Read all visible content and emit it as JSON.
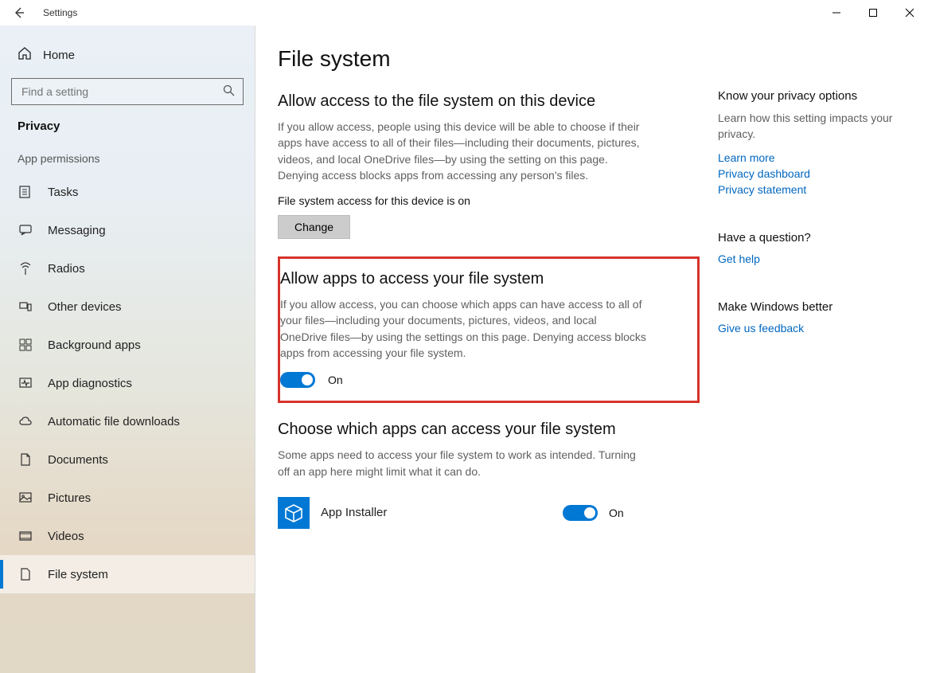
{
  "window": {
    "title": "Settings"
  },
  "sidebar": {
    "home": "Home",
    "search_placeholder": "Find a setting",
    "section": "Privacy",
    "subsection": "App permissions",
    "items": [
      {
        "label": "Tasks"
      },
      {
        "label": "Messaging"
      },
      {
        "label": "Radios"
      },
      {
        "label": "Other devices"
      },
      {
        "label": "Background apps"
      },
      {
        "label": "App diagnostics"
      },
      {
        "label": "Automatic file downloads"
      },
      {
        "label": "Documents"
      },
      {
        "label": "Pictures"
      },
      {
        "label": "Videos"
      },
      {
        "label": "File system"
      }
    ]
  },
  "page": {
    "title": "File system",
    "section1": {
      "title": "Allow access to the file system on this device",
      "desc": "If you allow access, people using this device will be able to choose if their apps have access to all of their files—including their documents, pictures, videos, and local OneDrive files—by using the setting on this page. Denying access blocks apps from accessing any person's files.",
      "status": "File system access for this device is on",
      "button": "Change"
    },
    "section2": {
      "title": "Allow apps to access your file system",
      "desc": "If you allow access, you can choose which apps can have access to all of your files—including your documents, pictures, videos, and local OneDrive files—by using the settings on this page. Denying access blocks apps from accessing your file system.",
      "toggle_label": "On"
    },
    "section3": {
      "title": "Choose which apps can access your file system",
      "desc": "Some apps need to access your file system to work as intended. Turning off an app here might limit what it can do.",
      "apps": [
        {
          "name": "App Installer",
          "toggle_label": "On"
        }
      ]
    }
  },
  "rail": {
    "group1": {
      "title": "Know your privacy options",
      "desc": "Learn how this setting impacts your privacy.",
      "links": [
        "Learn more",
        "Privacy dashboard",
        "Privacy statement"
      ]
    },
    "group2": {
      "title": "Have a question?",
      "links": [
        "Get help"
      ]
    },
    "group3": {
      "title": "Make Windows better",
      "links": [
        "Give us feedback"
      ]
    }
  }
}
